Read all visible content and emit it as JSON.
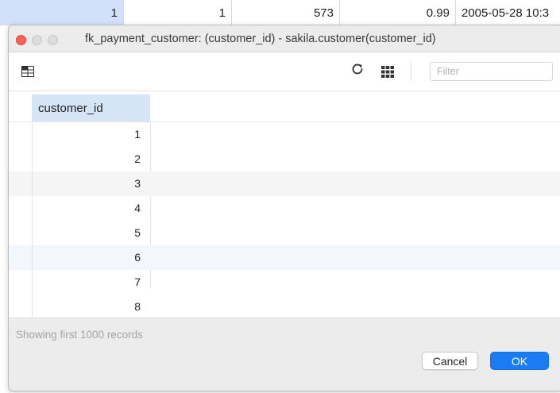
{
  "background_row": {
    "cells": [
      "1",
      "1",
      "573",
      "0.99",
      "2005-05-28 10:3"
    ]
  },
  "window": {
    "title": "fk_payment_customer: (customer_id) - sakila.customer(customer_id)"
  },
  "toolbar": {
    "layout_icon": "column-layout-icon",
    "refresh_icon": "refresh-icon",
    "grid_icon": "grid-icon",
    "filter_placeholder": "Filter",
    "filter_value": ""
  },
  "table": {
    "columns": [
      "customer_id"
    ],
    "rows": [
      "1",
      "2",
      "3",
      "4",
      "5",
      "6",
      "7",
      "8"
    ]
  },
  "footer": {
    "status": "Showing first 1000 records",
    "cancel_label": "Cancel",
    "ok_label": "OK"
  },
  "colors": {
    "accent": "#1a7cf5",
    "header_highlight": "#d6e4f8",
    "close_light": "#ff5f57"
  }
}
